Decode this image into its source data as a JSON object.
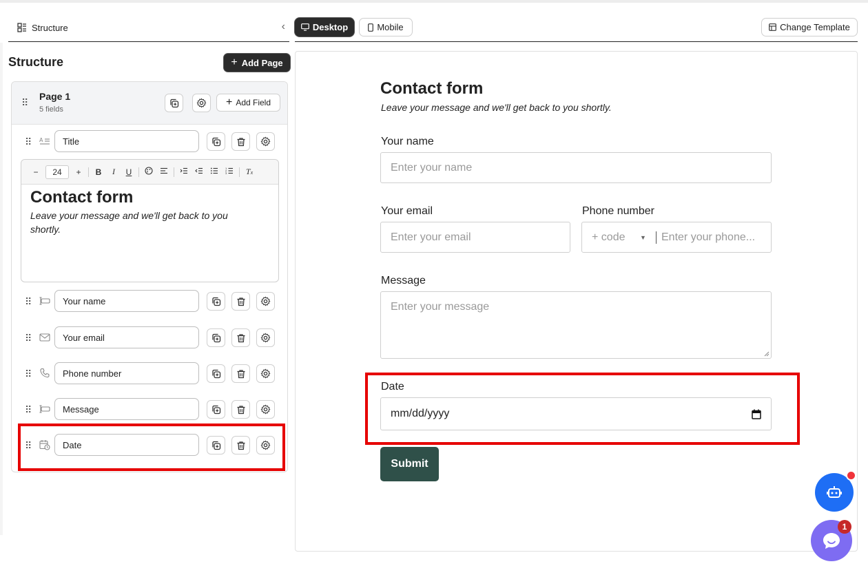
{
  "left_panel": {
    "header_label": "Structure",
    "title": "Structure",
    "add_page_label": "Add Page",
    "page": {
      "name": "Page 1",
      "field_count": "5 fields",
      "add_field_label": "Add Field"
    },
    "title_field": {
      "value": "Title"
    },
    "editor": {
      "font_size": "24",
      "minus": "−",
      "plus": "+",
      "heading": "Contact form",
      "subheading": "Leave your message and we'll get back to you shortly."
    },
    "fields": [
      {
        "value": "Your name",
        "icon": "text-input-icon"
      },
      {
        "value": "Your email",
        "icon": "mail-icon"
      },
      {
        "value": "Phone number",
        "icon": "phone-icon"
      },
      {
        "value": "Message",
        "icon": "text-input-icon"
      },
      {
        "value": "Date",
        "icon": "calendar-clock-icon"
      }
    ]
  },
  "preview": {
    "tabs": {
      "desktop": "Desktop",
      "mobile": "Mobile",
      "active": "Desktop"
    },
    "change_template_label": "Change Template",
    "form": {
      "title": "Contact form",
      "subtitle": "Leave your message and we'll get back to you shortly.",
      "name_label": "Your name",
      "name_placeholder": "Enter your name",
      "email_label": "Your email",
      "email_placeholder": "Enter your email",
      "phone_label": "Phone number",
      "phone_code": "+ code",
      "phone_placeholder": "Enter your phone...",
      "message_label": "Message",
      "message_placeholder": "Enter your message",
      "date_label": "Date",
      "date_placeholder": "mm/dd/yyyy",
      "submit_label": "Submit"
    }
  },
  "chat_badge_count": "1",
  "colors": {
    "highlight": "#e60000",
    "submit_bg": "#2f5049",
    "bot_button": "#1e6ef5",
    "chat_button": "#7e6cf2"
  }
}
